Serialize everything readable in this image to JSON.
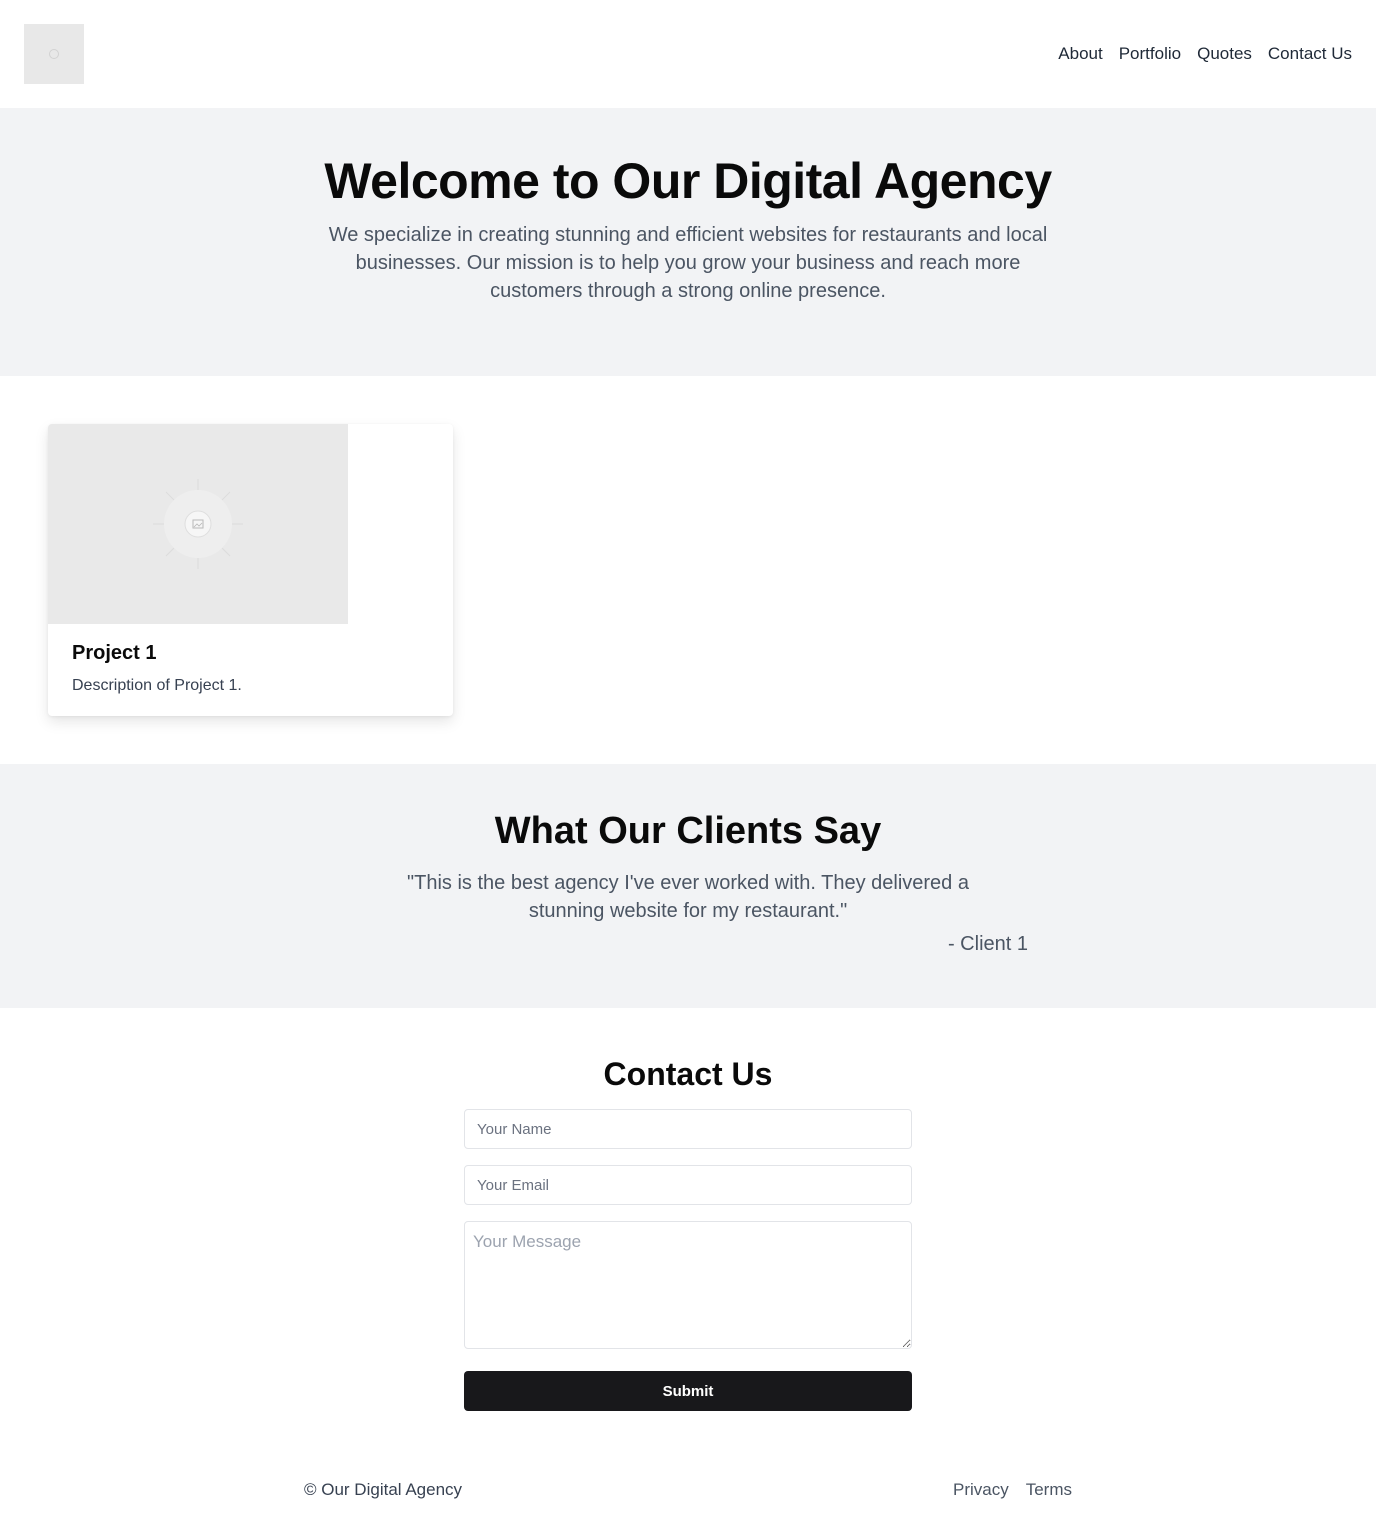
{
  "header": {
    "logo_icon": "image-placeholder-icon",
    "nav": [
      {
        "label": "About"
      },
      {
        "label": "Portfolio"
      },
      {
        "label": "Quotes"
      },
      {
        "label": "Contact Us"
      }
    ]
  },
  "hero": {
    "title": "Welcome to Our Digital Agency",
    "description": "We specialize in creating stunning and efficient websites for restaurants and local businesses. Our mission is to help you grow your business and reach more customers through a strong online presence."
  },
  "portfolio": {
    "projects": [
      {
        "title": "Project 1",
        "description": "Description of Project 1.",
        "image_icon": "image-placeholder-icon"
      }
    ]
  },
  "testimonials": {
    "title": "What Our Clients Say",
    "quote": "\"This is the best agency I've ever worked with. They delivered a stunning website for my restaurant.\"",
    "author": "- Client 1"
  },
  "contact": {
    "title": "Contact Us",
    "name_placeholder": "Your Name",
    "email_placeholder": "Your Email",
    "message_placeholder": "Your Message",
    "submit_label": "Submit"
  },
  "footer": {
    "copyright": "© Our Digital Agency",
    "links": [
      {
        "label": "Privacy"
      },
      {
        "label": "Terms"
      }
    ]
  },
  "colors": {
    "section_bg": "#f2f3f5",
    "button_bg": "#18181b",
    "text_muted": "#4b5563"
  }
}
